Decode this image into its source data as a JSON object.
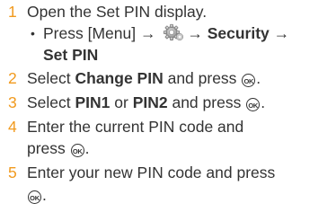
{
  "steps": [
    {
      "number": "1",
      "text_a": "Open the Set PIN display."
    },
    {
      "number": "2",
      "text_a": "Select ",
      "bold_a": "Change PIN",
      "text_b": " and press "
    },
    {
      "number": "3",
      "text_a": "Select ",
      "bold_a": "PIN1",
      "text_b": " or ",
      "bold_b": "PIN2",
      "text_c": " and press "
    },
    {
      "number": "4",
      "text_a": "Enter the current PIN code and",
      "text_b": "press "
    },
    {
      "number": "5",
      "text_a": "Enter your new PIN code and press"
    }
  ],
  "substep": {
    "bullet": "•",
    "text_a": "Press [Menu] → ",
    "arrow": "→",
    "bold_a": "Security",
    "arrow2": "→",
    "bold_b": "Set PIN"
  },
  "ok_key_label": "OK",
  "period": ".",
  "icons": [
    "settings-gear-icon",
    "ok-key-icon"
  ],
  "colors": {
    "step_number": "#f19a1e",
    "text": "#333333"
  }
}
